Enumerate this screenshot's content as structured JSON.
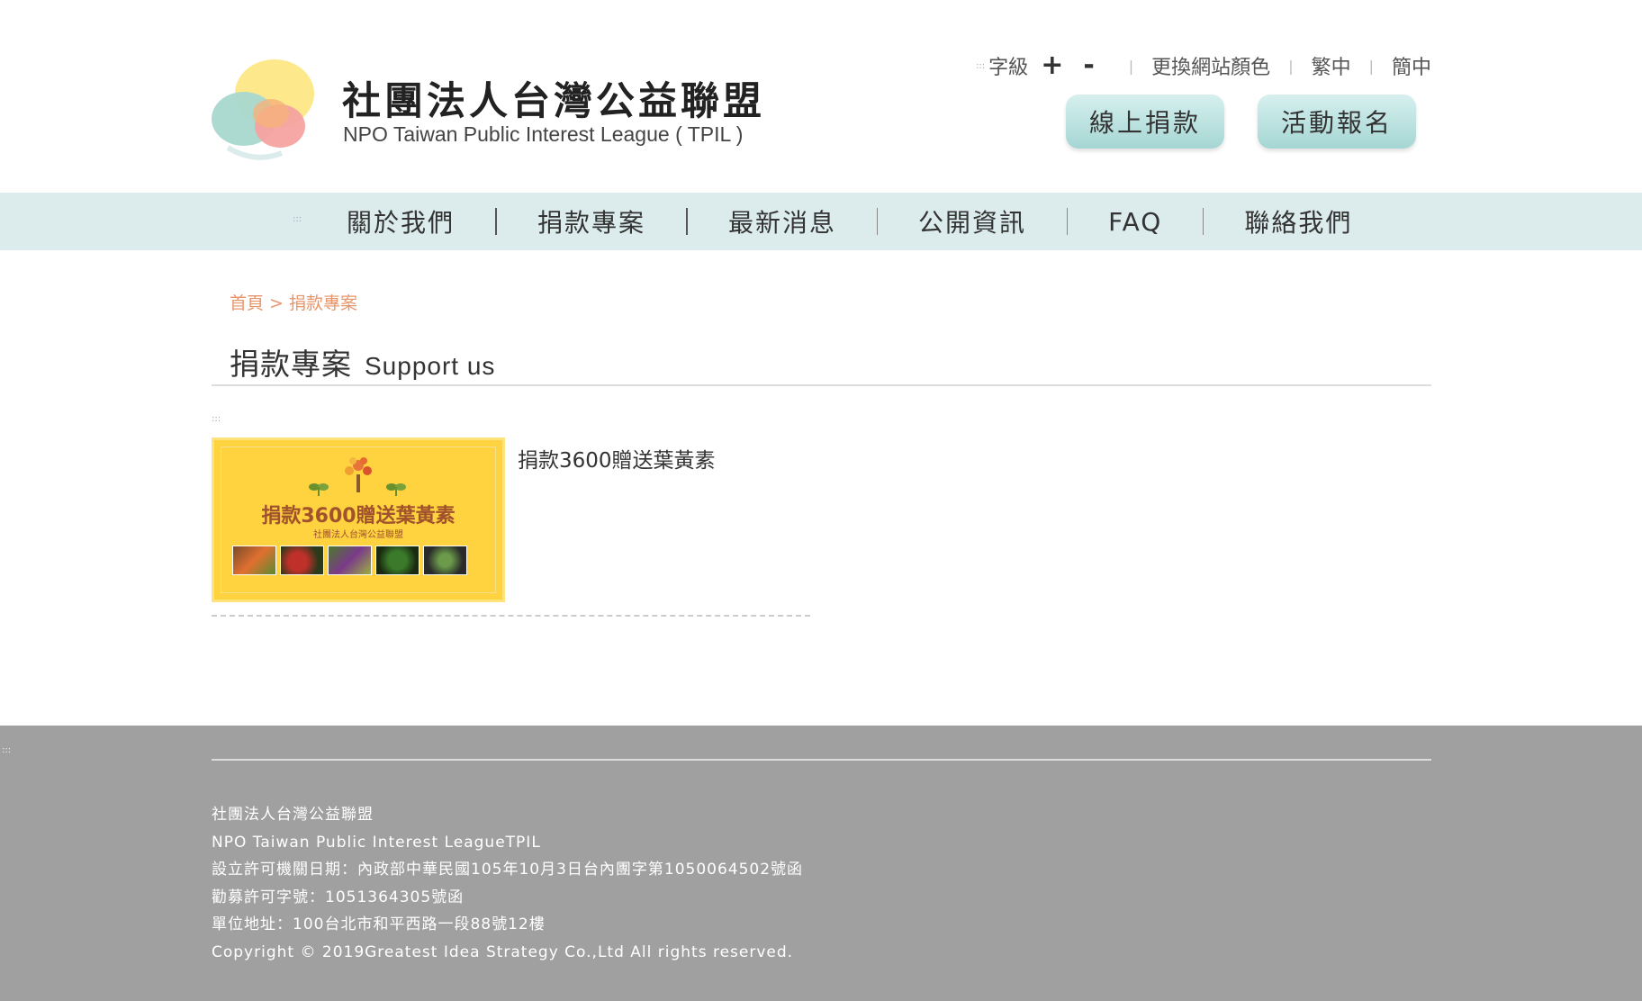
{
  "header": {
    "org_name": "社團法人台灣公益聯盟",
    "org_name_en": "NPO Taiwan Public Interest League ( TPIL )",
    "toolbar": {
      "accesskey": ":::",
      "font_size_label": "字級",
      "font_increase": "+",
      "font_decrease": "-",
      "change_color": "更換網站顏色",
      "traditional": "繁中",
      "simplified": "簡中"
    },
    "donate_button": "線上捐款",
    "event_button": "活動報名"
  },
  "nav": {
    "accesskey": ":::",
    "items": [
      {
        "label": "關於我們"
      },
      {
        "label": "捐款專案"
      },
      {
        "label": "最新消息"
      },
      {
        "label": "公開資訊"
      },
      {
        "label": "FAQ"
      },
      {
        "label": "聯絡我們"
      }
    ]
  },
  "breadcrumb": {
    "home": "首頁",
    "separator": " > ",
    "current": "捐款專案"
  },
  "page": {
    "title_zh": "捐款專案",
    "title_en": "Support us",
    "accesskey": ":::"
  },
  "projects": [
    {
      "title": "捐款3600贈送葉黃素",
      "thumb_heading": "捐款3600贈送葉黃素",
      "thumb_sub": "社團法人台灣公益聯盟"
    }
  ],
  "footer": {
    "accesskey": ":::",
    "lines": [
      "社團法人台灣公益聯盟",
      "NPO Taiwan Public Interest LeagueTPIL",
      "設立許可機關日期：內政部中華民國105年10月3日台內團字第1050064502號函",
      "勸募許可字號：1051364305號函",
      "單位地址：100台北市和平西路一段88號12樓",
      "Copyright © 2019Greatest Idea Strategy Co.,Ltd All rights reserved."
    ]
  },
  "colors": {
    "nav_bg": "#dcecec",
    "pill_bg": "#a5d6d3",
    "breadcrumb": "#e8956b",
    "footer_bg": "#a0a0a0",
    "thumb_bg": "#ffd23f"
  }
}
